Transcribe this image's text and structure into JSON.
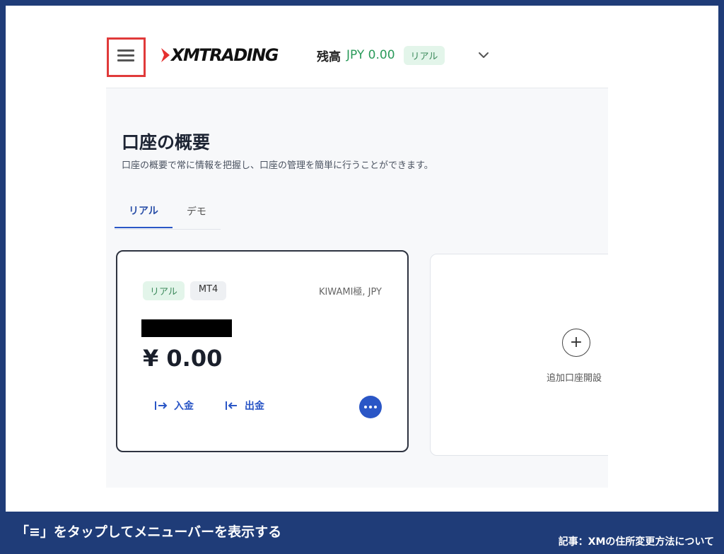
{
  "header": {
    "logo_text": "XMTRADING",
    "balance_label": "残高",
    "balance_value": "JPY 0.00",
    "account_mode_badge": "リアル"
  },
  "page": {
    "title": "口座の概要",
    "subtitle": "口座の概要で常に情報を把握し、口座の管理を簡単に行うことができます。"
  },
  "tabs": [
    {
      "label": "リアル",
      "active": true
    },
    {
      "label": "デモ",
      "active": false
    }
  ],
  "account_card": {
    "badge_mode": "リアル",
    "badge_platform": "MT4",
    "account_type": "KIWAMI極, JPY",
    "balance": "¥ 0.00",
    "deposit_label": "入金",
    "withdraw_label": "出金"
  },
  "add_card": {
    "label": "追加口座開設"
  },
  "footer": {
    "caption": "「≡」をタップしてメニューバーを表示する",
    "article": "記事：XMの住所変更方法について"
  },
  "colors": {
    "frame": "#1f3c78",
    "highlight": "#e03a3a",
    "accent_blue": "#2a56c6",
    "balance_green": "#2a9a5a"
  },
  "icons": [
    "hamburger-menu-icon",
    "chevron-down-icon",
    "deposit-arrow-icon",
    "withdraw-arrow-icon",
    "more-dots-icon",
    "plus-icon"
  ]
}
